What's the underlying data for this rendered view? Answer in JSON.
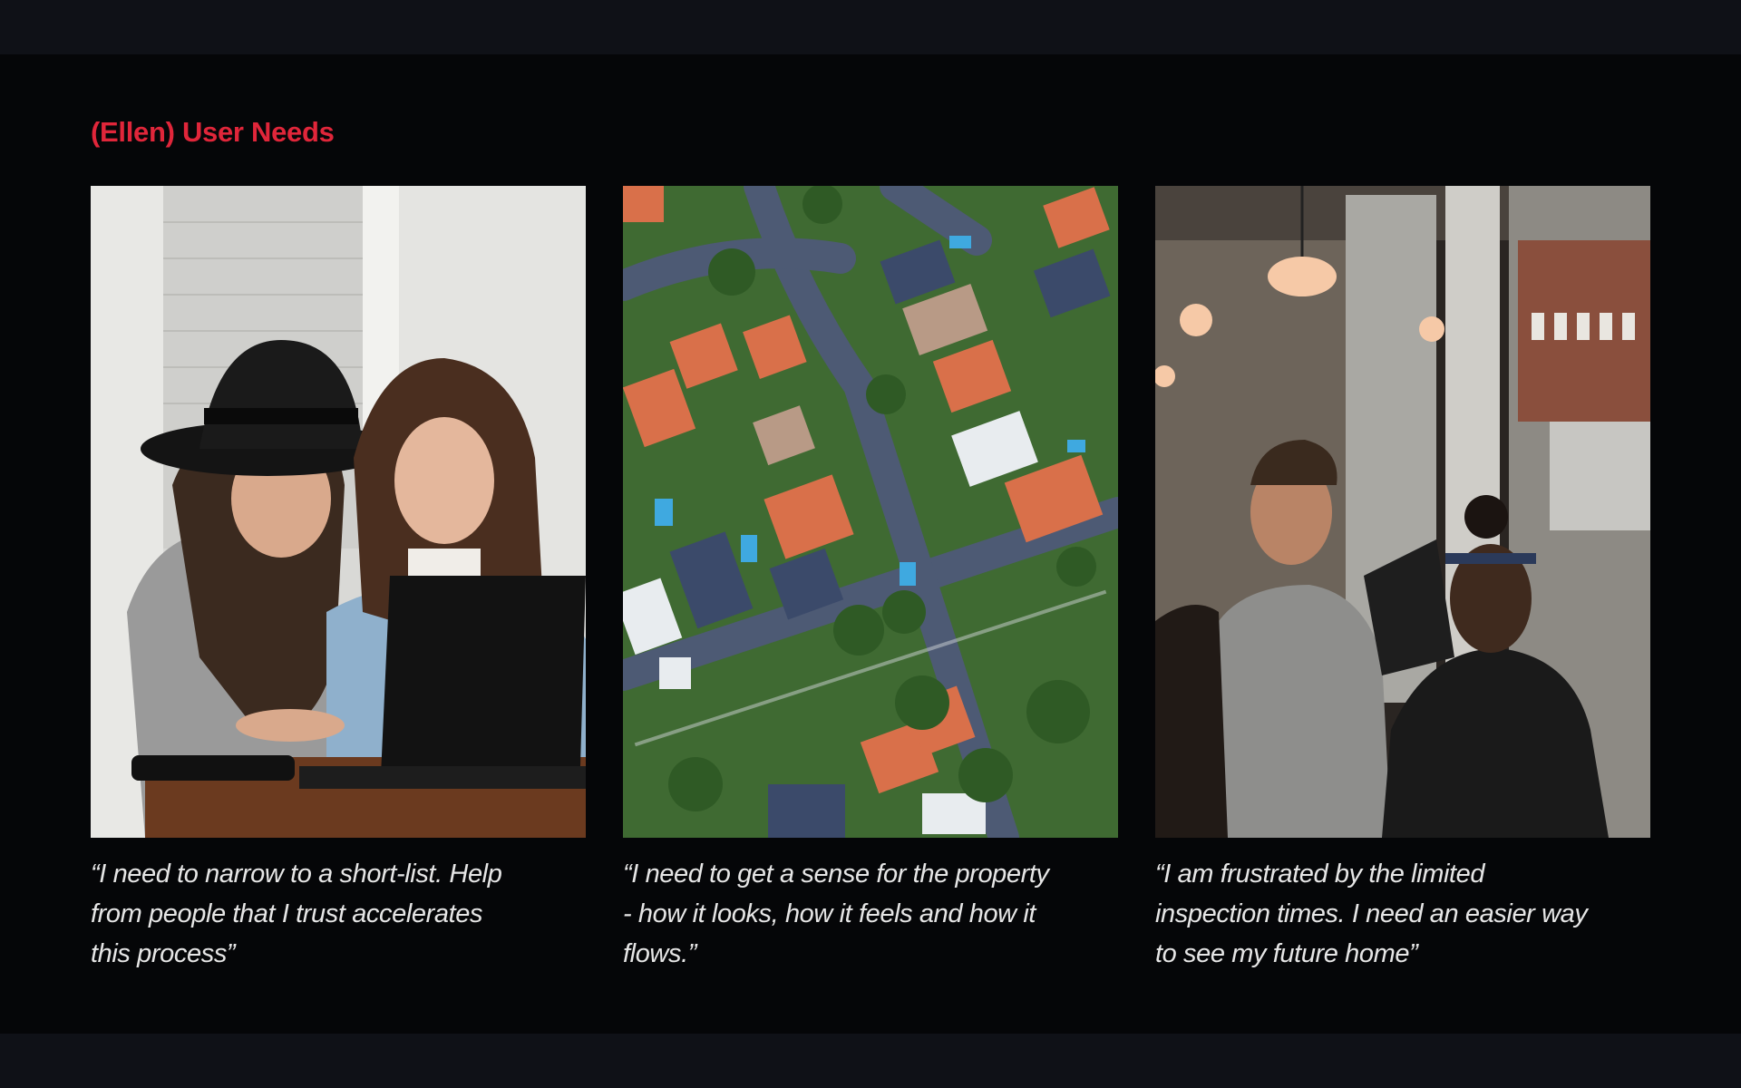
{
  "slide": {
    "title": "(Ellen) User Needs"
  },
  "cards": [
    {
      "image": "two-women-laptop-photo",
      "quote": "“I need to narrow to a short-list. Help from people that I trust accelerates this process”"
    },
    {
      "image": "aerial-suburb-photo",
      "quote": "“I need to get a sense for the property - how it looks, how it feels and how it flows.”"
    },
    {
      "image": "cafe-window-photo",
      "quote": "“I am frustrated by the limited inspection times. I need an easier way to see my future home”"
    }
  ],
  "colors": {
    "title_accent": "#e0263a",
    "slide_background": "#050608",
    "chrome_background": "#0f1117",
    "quote_text": "#e6e6e6"
  }
}
